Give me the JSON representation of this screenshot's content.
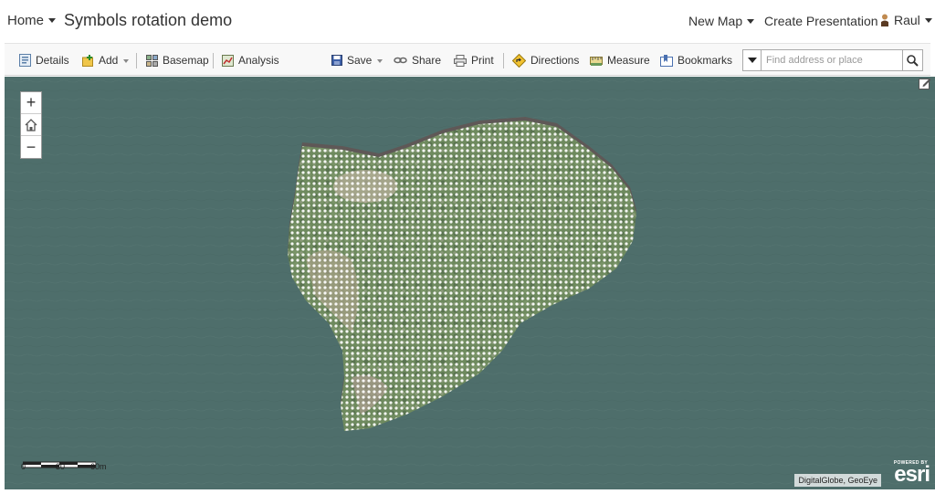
{
  "header": {
    "home_label": "Home",
    "title": "Symbols rotation demo",
    "new_map_label": "New Map",
    "create_presentation_label": "Create Presentation",
    "user_name": "Raul"
  },
  "toolbar": {
    "details_label": "Details",
    "add_label": "Add",
    "basemap_label": "Basemap",
    "analysis_label": "Analysis",
    "save_label": "Save",
    "share_label": "Share",
    "print_label": "Print",
    "directions_label": "Directions",
    "measure_label": "Measure",
    "bookmarks_label": "Bookmarks"
  },
  "search": {
    "placeholder": "Find address or place"
  },
  "map": {
    "zoom_in_label": "+",
    "zoom_out_label": "−",
    "scale_labels": [
      "0",
      "30",
      "60m"
    ],
    "attribution": "DigitalGlobe, GeoEye",
    "esri_powered_by": "POWERED BY",
    "esri_brand": "esri",
    "water_color": "#4e6e6b",
    "land_color": "#6e8a5e",
    "point_symbol_color": "#ffffff"
  },
  "icons": {
    "details": "details-icon",
    "add": "add-icon",
    "basemap": "basemap-icon",
    "analysis": "analysis-icon",
    "save": "save-icon",
    "share": "share-icon",
    "print": "print-icon",
    "directions": "directions-icon",
    "measure": "measure-icon",
    "bookmarks": "bookmarks-icon",
    "search": "search-icon",
    "home": "home-icon",
    "edit": "edit-icon"
  }
}
